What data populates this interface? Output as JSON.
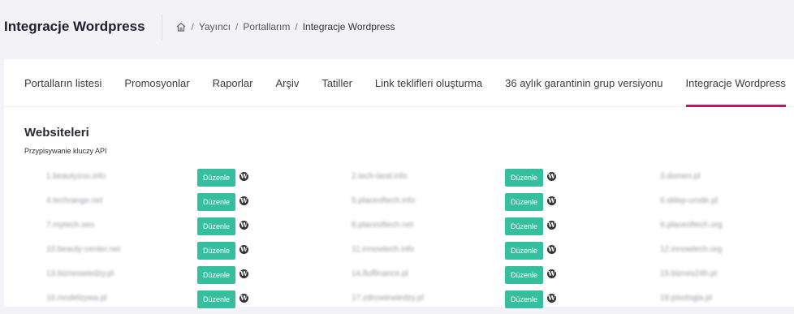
{
  "header": {
    "title": "Integracje Wordpress",
    "breadcrumb": [
      "Yayıncı",
      "Portallarım",
      "Integracje Wordpress"
    ]
  },
  "tabs": [
    {
      "label": "Portalların listesi"
    },
    {
      "label": "Promosyonlar"
    },
    {
      "label": "Raporlar"
    },
    {
      "label": "Arşiv"
    },
    {
      "label": "Tatiller"
    },
    {
      "label": "Link teklifleri oluşturma"
    },
    {
      "label": "36 aylık garantinin grup versiyonu"
    },
    {
      "label": "Integracje Wordpress",
      "active": true
    }
  ],
  "section": {
    "title": "Websiteleri",
    "subtitle": "Przypisywanie kluczy API"
  },
  "edit_label": "Düzenle",
  "rows": [
    [
      "1.beautyzoo.info",
      "2.tech-land.info",
      "3.domen.pl"
    ],
    [
      "4.techrange.net",
      "5.placeoftech.info",
      "6.sklep-urode.pl"
    ],
    [
      "7.mytech.seo",
      "8.placeoftech.net",
      "9.placeoftech.org"
    ],
    [
      "10.beauty-center.net",
      "11.innowtech.info",
      "12.innowtech.org"
    ],
    [
      "13.bizneswiedzy.pl",
      "14.fluffinance.pl",
      "15.biznes24h.pl"
    ],
    [
      "16.modelzywa.pl",
      "17.zdrowiewiedzy.pl",
      "18.pisologia.pl"
    ]
  ],
  "colors": {
    "accent": "#c2185b",
    "button": "#36bf9e"
  }
}
